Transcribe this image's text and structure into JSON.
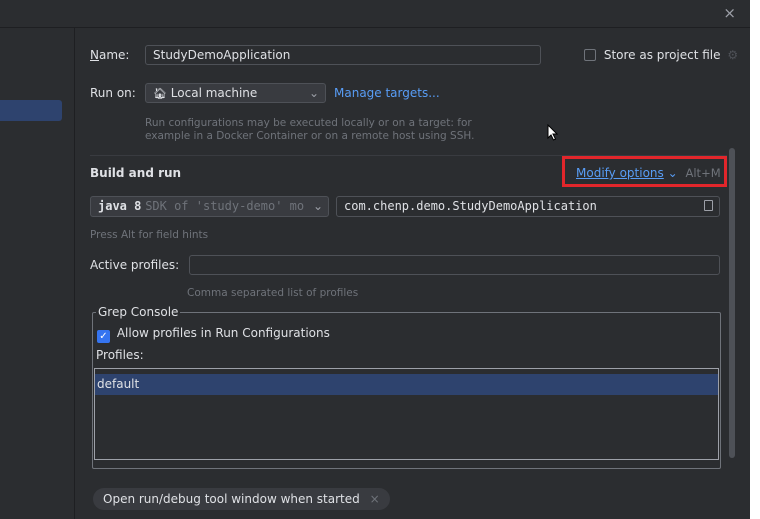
{
  "window": {
    "close_glyph": "×"
  },
  "form": {
    "name_label": "Name:",
    "name_value": "StudyDemoApplication",
    "store_label": "Store as project file",
    "run_on_label": "Run on:",
    "run_on_value": "Local machine",
    "manage_targets": "Manage targets...",
    "run_on_hint_1": "Run configurations may be executed locally or on a target: for",
    "run_on_hint_2": "example in a Docker Container or on a remote host using SSH."
  },
  "build": {
    "title": "Build and run",
    "modify_options": "Modify options",
    "modify_shortcut": "Alt+M",
    "sdk_bold": "java 8",
    "sdk_desc": "SDK of 'study-demo' mo",
    "main_class": "com.chenp.demo.StudyDemoApplication",
    "field_hints": "Press Alt for field hints",
    "active_profiles_label": "Active profiles:",
    "active_profiles_value": "",
    "active_profiles_hint": "Comma separated list of profiles"
  },
  "grep": {
    "group_title": "Grep Console",
    "allow_label": "Allow profiles in Run Configurations",
    "allow_checked": true,
    "profiles_label": "Profiles:",
    "profiles": [
      "default"
    ]
  },
  "footer": {
    "chip_label": "Open run/debug tool window when started",
    "chip_close": "×"
  },
  "colors": {
    "accent": "#3574f0",
    "link": "#589df6",
    "highlight_box": "#e2262b",
    "selection": "#2e436e"
  }
}
